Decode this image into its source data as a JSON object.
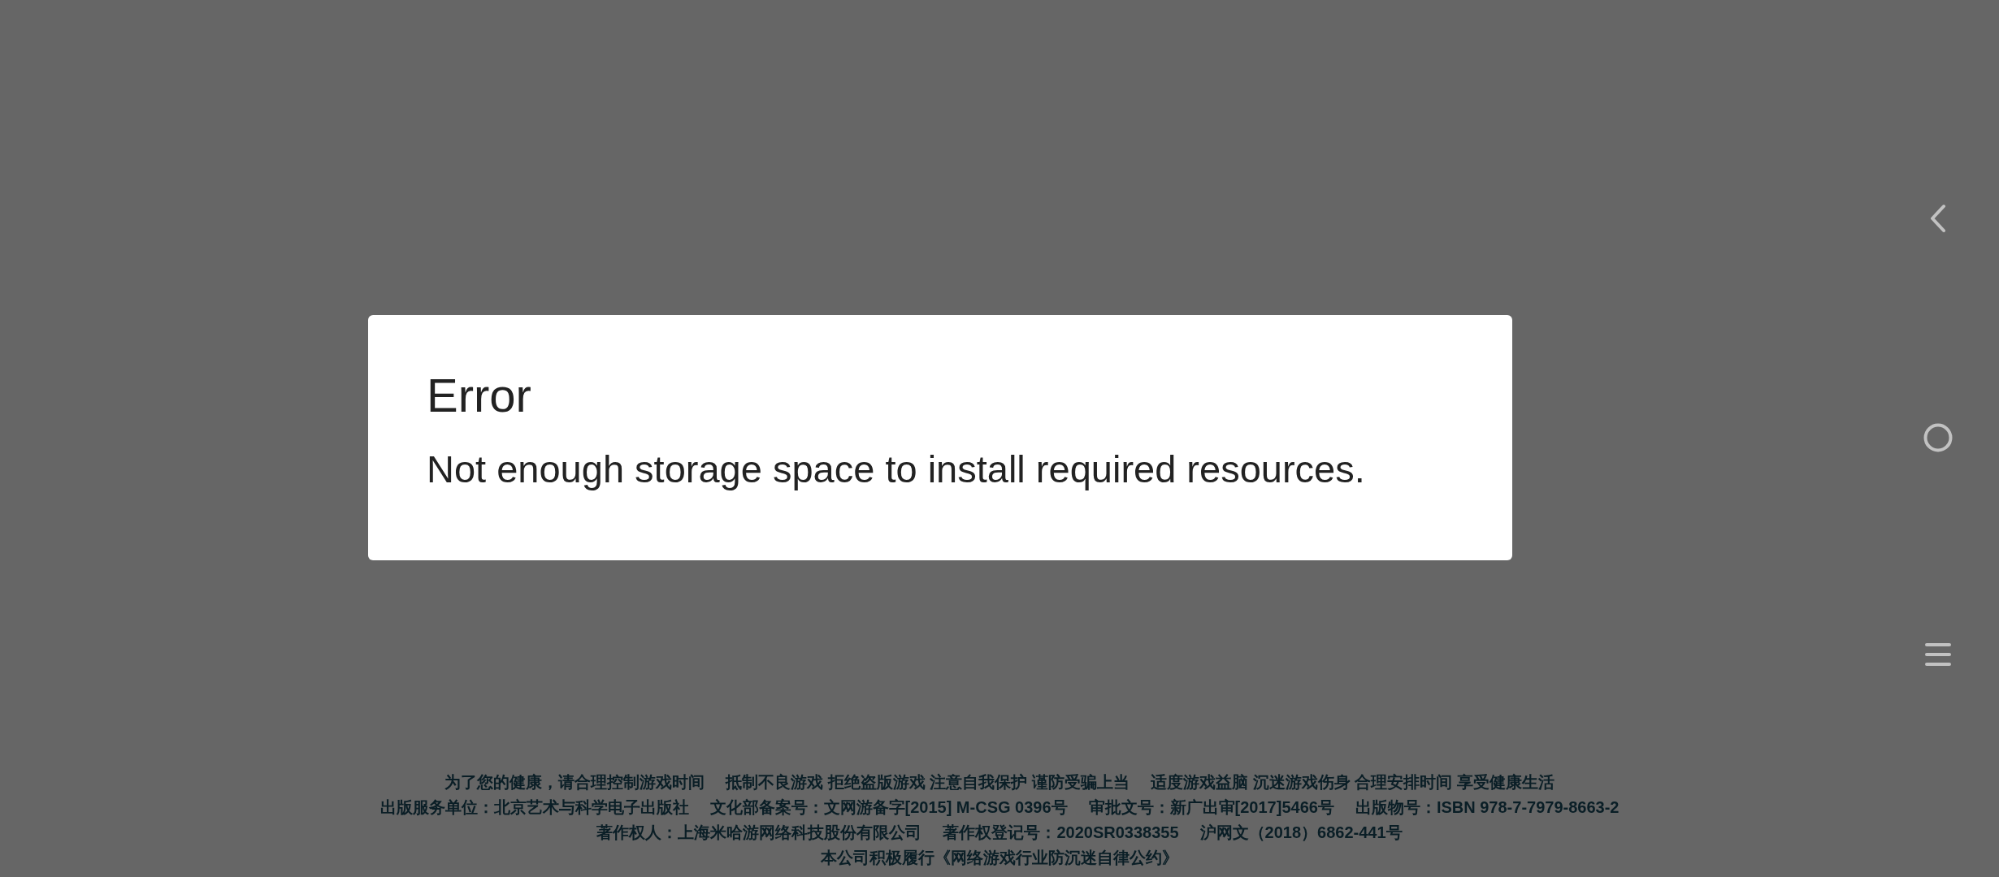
{
  "dialog": {
    "title": "Error",
    "message": "Not enough storage space to install required resources."
  },
  "footer": {
    "lines": [
      [
        "为了您的健康，请合理控制游戏时间",
        "抵制不良游戏 拒绝盗版游戏 注意自我保护 谨防受骗上当",
        "适度游戏益脑 沉迷游戏伤身 合理安排时间 享受健康生活"
      ],
      [
        "出版服务单位：北京艺术与科学电子出版社",
        "文化部备案号：文网游备字[2015] M-CSG 0396号",
        "审批文号：新广出审[2017]5466号",
        "出版物号：ISBN 978-7-7979-8663-2"
      ],
      [
        "著作权人：上海米哈游网络科技股份有限公司",
        "著作权登记号：2020SR0338355",
        "沪网文（2018）6862-441号"
      ],
      [
        "本公司积极履行《网络游戏行业防沉迷自律公约》"
      ]
    ]
  },
  "nav_bar": {
    "buttons": [
      {
        "kind": "back"
      },
      {
        "kind": "home"
      },
      {
        "kind": "menu"
      }
    ]
  }
}
